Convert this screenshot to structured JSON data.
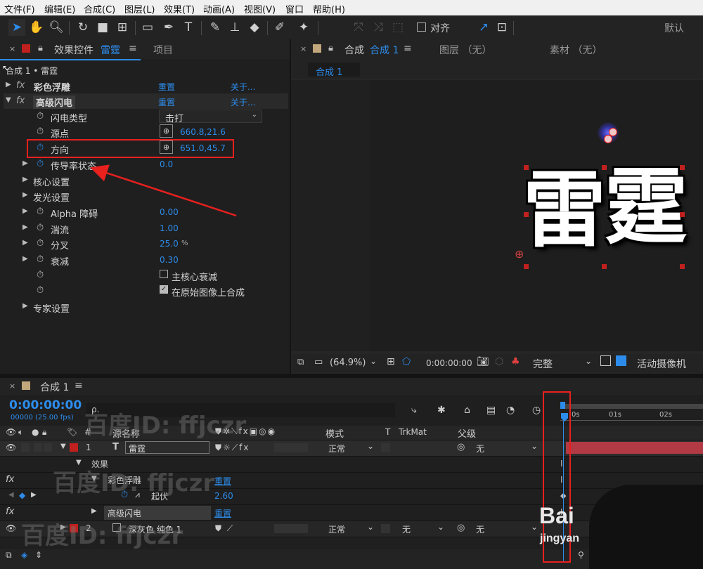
{
  "menu": [
    "文件(F)",
    "编辑(E)",
    "合成(C)",
    "图层(L)",
    "效果(T)",
    "动画(A)",
    "视图(V)",
    "窗口",
    "帮助(H)"
  ],
  "toolbar": {
    "align_label": "对齐",
    "workspace": "默认"
  },
  "effect_panel": {
    "tab_label": "效果控件",
    "tab_layer": "雷霆",
    "project_tab": "项目",
    "breadcrumb": "合成 1 • 雷霆",
    "effects": [
      {
        "name": "彩色浮雕",
        "reset": "重置",
        "about": "关于..."
      },
      {
        "name": "高级闪电",
        "reset": "重置",
        "about": "关于..."
      }
    ],
    "lightning_type_label": "闪电类型",
    "lightning_type_value": "击打",
    "origin_label": "源点",
    "origin_value": "660.8,21.6",
    "direction_label": "方向",
    "direction_value": "651.0,45.7",
    "conductivity_label": "传导率状态",
    "conductivity_value": "0.0",
    "core_label": "核心设置",
    "glow_label": "发光设置",
    "alpha_label": "Alpha 障碍",
    "alpha_value": "0.00",
    "turbulence_label": "湍流",
    "turbulence_value": "1.00",
    "fork_label": "分叉",
    "fork_value": "25.0",
    "fork_unit": "%",
    "decay_label": "衰减",
    "decay_value": "0.30",
    "main_core_decay_label": "主核心衰减",
    "composite_label": "在原始图像上合成",
    "expert_label": "专家设置"
  },
  "composition_panel": {
    "tab_prefix": "合成",
    "tab_name": "合成 1",
    "layer_tab": "图层 （无）",
    "footage_tab": "素材 （无）",
    "sub_tab": "合成 1",
    "chars": [
      "雷",
      "霆"
    ],
    "zoom": "(64.9%)",
    "timecode": "0:00:00:00",
    "quality": "完整",
    "camera": "活动摄像机"
  },
  "timeline": {
    "tab": "合成 1",
    "timecode": "0:00:00:00",
    "frames": "00000 (25.00 fps)",
    "search_placeholder": "ρ.",
    "col_source": "源名称",
    "col_mode": "模式",
    "col_t": "T",
    "col_trkmat": "TrkMat",
    "col_parent": "父级",
    "ruler": [
      "0s",
      "01s",
      "02s"
    ],
    "layer1": {
      "num": "1",
      "type": "T",
      "name": "雷霆",
      "mode": "正常",
      "parent": "无"
    },
    "effects_group": "效果",
    "fx1": {
      "name": "彩色浮雕",
      "reset": "重置"
    },
    "fx1_prop": {
      "label": "起伏",
      "value": "2.60"
    },
    "fx2": {
      "name": "高级闪电",
      "reset": "重置"
    },
    "layer2": {
      "num": "2",
      "name": "深灰色 纯色 1",
      "mode": "正常",
      "trkmat": "无",
      "parent": "无"
    }
  },
  "watermark": {
    "text": "百度ID: ffjczr",
    "brand": "Bai",
    "brand_sub": "jingyan"
  },
  "colors": {
    "accent": "#2d8ceb",
    "annotation": "#e8201e",
    "label_red": "#c0201e",
    "bar_red": "#b23a44"
  }
}
